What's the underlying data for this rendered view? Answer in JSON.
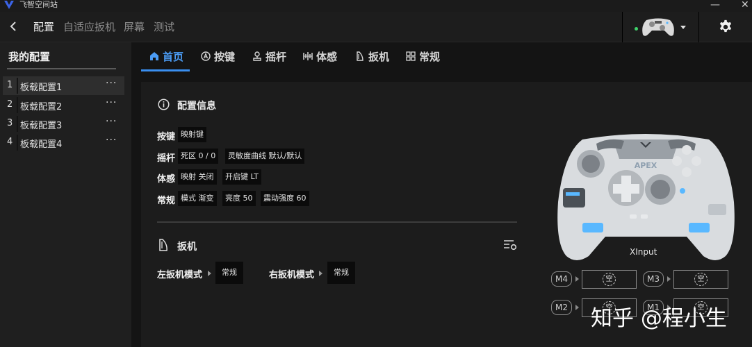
{
  "window": {
    "title": "飞智空间站",
    "minimize": "—",
    "close": "✕"
  },
  "topnav": {
    "items": [
      {
        "label": "配置",
        "active": true
      },
      {
        "label": "自适应扳机",
        "active": false
      },
      {
        "label": "屏幕",
        "active": false
      },
      {
        "label": "测试",
        "active": false
      }
    ],
    "connection_status_color": "#3fd36b"
  },
  "sidebar": {
    "title": "我的配置",
    "configs": [
      {
        "num": "1",
        "name": "板载配置1",
        "selected": true,
        "more": "···"
      },
      {
        "num": "2",
        "name": "板载配置2",
        "selected": false,
        "more": "···"
      },
      {
        "num": "3",
        "name": "板载配置3",
        "selected": false,
        "more": "···"
      },
      {
        "num": "4",
        "name": "板载配置4",
        "selected": false,
        "more": "···"
      }
    ]
  },
  "tabs": [
    {
      "label": "首页",
      "icon": "home-icon",
      "active": true
    },
    {
      "label": "按键",
      "icon": "a-button-icon",
      "active": false
    },
    {
      "label": "摇杆",
      "icon": "joystick-icon",
      "active": false
    },
    {
      "label": "体感",
      "icon": "motion-icon",
      "active": false
    },
    {
      "label": "扳机",
      "icon": "trigger-icon",
      "active": false
    },
    {
      "label": "常规",
      "icon": "grid-icon",
      "active": false
    }
  ],
  "config_info": {
    "title": "配置信息",
    "rows": [
      {
        "label": "按键",
        "chips": [
          "映射键"
        ]
      },
      {
        "label": "摇杆",
        "chips": [
          "死区 0 / 0",
          "灵敏度曲线 默认/默认"
        ]
      },
      {
        "label": "体感",
        "chips": [
          "映射 关闭",
          "开启键 LT"
        ]
      },
      {
        "label": "常规",
        "chips": [
          "模式 渐变",
          "亮度 50",
          "震动强度 60"
        ]
      }
    ]
  },
  "trigger": {
    "title": "扳机",
    "left_label": "左扳机模式",
    "left_value": "常规",
    "right_label": "右扳机模式",
    "right_value": "常规"
  },
  "controller": {
    "brand": "APEX",
    "mode": "XInput",
    "accent_color": "#59b8ff"
  },
  "macros": [
    {
      "name": "M4",
      "value": "空"
    },
    {
      "name": "M3",
      "value": "空"
    },
    {
      "name": "M2",
      "value": "空"
    },
    {
      "name": "M1",
      "value": "空"
    }
  ],
  "watermark": "知乎 @程小生"
}
